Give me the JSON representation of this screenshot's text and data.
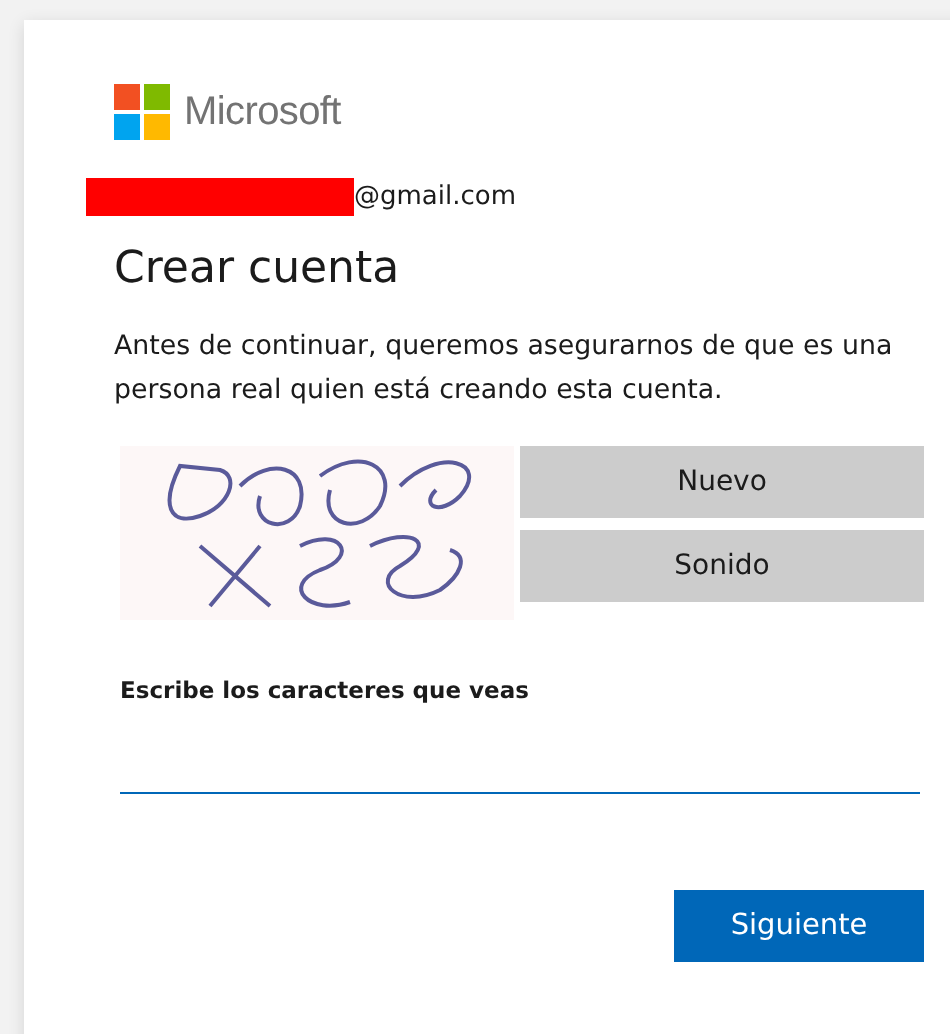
{
  "brand": "Microsoft",
  "email": {
    "redacted": true,
    "text": "@gmail.com"
  },
  "title": "Crear cuenta",
  "description": "Antes de continuar, queremos asegurarnos de que es una persona real quien está creando esta cuenta.",
  "captcha": {
    "buttons": [
      "Nuevo",
      "Sonido"
    ]
  },
  "field": {
    "label": "Escribe los caracteres que veas"
  },
  "submit": "Siguiente"
}
